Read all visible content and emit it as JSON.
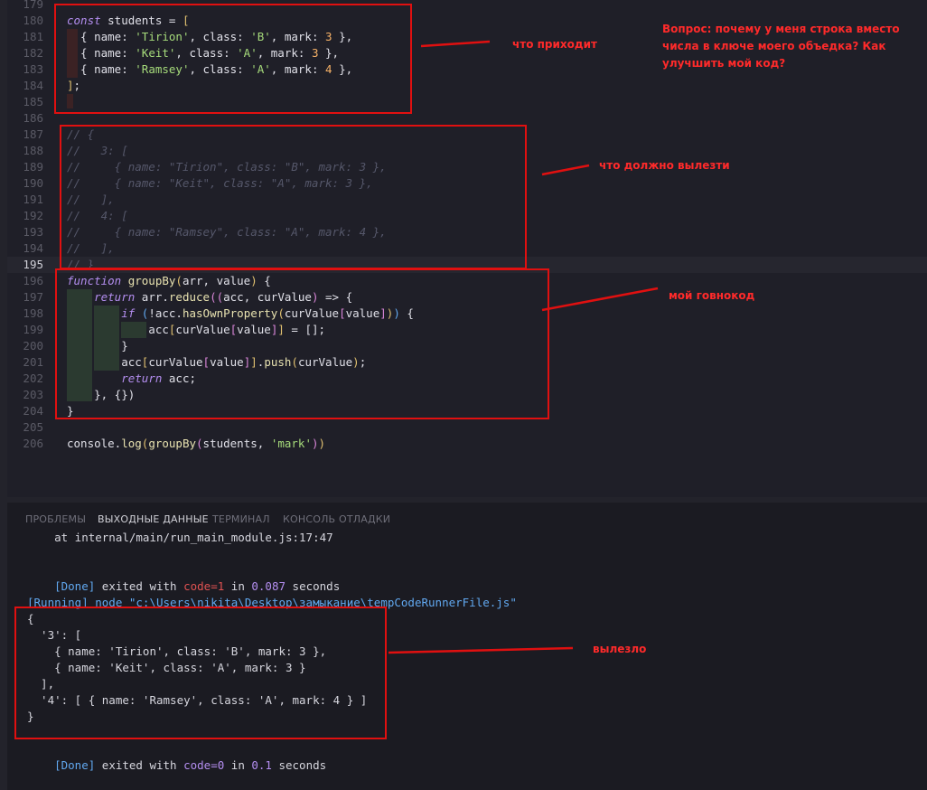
{
  "editor": {
    "lines": [
      {
        "n": "179",
        "segs": []
      },
      {
        "n": "180",
        "segs": [
          [
            "kw",
            "const "
          ],
          [
            "pr",
            "students = "
          ],
          [
            "br1",
            "["
          ]
        ]
      },
      {
        "n": "181",
        "segs": [
          [
            "pr",
            "  { name: "
          ],
          [
            "str",
            "'Tirion'"
          ],
          [
            "pr",
            ", class: "
          ],
          [
            "str",
            "'B'"
          ],
          [
            "pr",
            ", mark: "
          ],
          [
            "num",
            "3"
          ],
          [
            "pr",
            " },"
          ]
        ]
      },
      {
        "n": "182",
        "segs": [
          [
            "pr",
            "  { name: "
          ],
          [
            "str",
            "'Keit'"
          ],
          [
            "pr",
            ", class: "
          ],
          [
            "str",
            "'A'"
          ],
          [
            "pr",
            ", mark: "
          ],
          [
            "num",
            "3"
          ],
          [
            "pr",
            " },"
          ]
        ]
      },
      {
        "n": "183",
        "segs": [
          [
            "pr",
            "  { name: "
          ],
          [
            "str",
            "'Ramsey'"
          ],
          [
            "pr",
            ", class: "
          ],
          [
            "str",
            "'A'"
          ],
          [
            "pr",
            ", mark: "
          ],
          [
            "num",
            "4"
          ],
          [
            "pr",
            " },"
          ]
        ]
      },
      {
        "n": "184",
        "segs": [
          [
            "br1",
            "]"
          ],
          [
            "pr",
            ";"
          ]
        ]
      },
      {
        "n": "185",
        "segs": []
      },
      {
        "n": "186",
        "segs": []
      },
      {
        "n": "187",
        "segs": [
          [
            "cm",
            "// {"
          ]
        ]
      },
      {
        "n": "188",
        "segs": [
          [
            "cm",
            "//   3: ["
          ]
        ]
      },
      {
        "n": "189",
        "segs": [
          [
            "cm",
            "//     { name: \"Tirion\", class: \"B\", mark: 3 },"
          ]
        ]
      },
      {
        "n": "190",
        "segs": [
          [
            "cm",
            "//     { name: \"Keit\", class: \"A\", mark: 3 },"
          ]
        ]
      },
      {
        "n": "191",
        "segs": [
          [
            "cm",
            "//   ],"
          ]
        ]
      },
      {
        "n": "192",
        "segs": [
          [
            "cm",
            "//   4: ["
          ]
        ]
      },
      {
        "n": "193",
        "segs": [
          [
            "cm",
            "//     { name: \"Ramsey\", class: \"A\", mark: 4 },"
          ]
        ]
      },
      {
        "n": "194",
        "segs": [
          [
            "cm",
            "//   ],"
          ]
        ]
      },
      {
        "n": "195",
        "segs": [
          [
            "cm",
            "// }"
          ]
        ]
      },
      {
        "n": "196",
        "segs": [
          [
            "kw",
            "function "
          ],
          [
            "fn",
            "groupBy"
          ],
          [
            "br1",
            "("
          ],
          [
            "pr",
            "arr, value"
          ],
          [
            "br1",
            ")"
          ],
          [
            "pr",
            " {"
          ]
        ]
      },
      {
        "n": "197",
        "segs": [
          [
            "pr",
            "    "
          ],
          [
            "kw",
            "return "
          ],
          [
            "pr",
            "arr."
          ],
          [
            "fn",
            "reduce"
          ],
          [
            "br2",
            "(("
          ],
          [
            "pr",
            "acc, curValue"
          ],
          [
            "br2",
            ")"
          ],
          [
            "pr",
            " => {"
          ]
        ]
      },
      {
        "n": "198",
        "segs": [
          [
            "pr",
            "        "
          ],
          [
            "kw",
            "if "
          ],
          [
            "br3",
            "("
          ],
          [
            "pr",
            "!acc."
          ],
          [
            "fn",
            "hasOwnProperty"
          ],
          [
            "br1",
            "("
          ],
          [
            "pr",
            "curValue"
          ],
          [
            "br2",
            "["
          ],
          [
            "pr",
            "value"
          ],
          [
            "br2",
            "]"
          ],
          [
            "br1",
            ")"
          ],
          [
            "br3",
            ")"
          ],
          [
            "pr",
            " {"
          ]
        ]
      },
      {
        "n": "199",
        "segs": [
          [
            "pr",
            "            acc"
          ],
          [
            "br1",
            "["
          ],
          [
            "pr",
            "curValue"
          ],
          [
            "br2",
            "["
          ],
          [
            "pr",
            "value"
          ],
          [
            "br2",
            "]"
          ],
          [
            "br1",
            "]"
          ],
          [
            "pr",
            " = [];"
          ]
        ]
      },
      {
        "n": "200",
        "segs": [
          [
            "pr",
            "        }"
          ]
        ]
      },
      {
        "n": "201",
        "segs": [
          [
            "pr",
            "        acc"
          ],
          [
            "br1",
            "["
          ],
          [
            "pr",
            "curValue"
          ],
          [
            "br2",
            "["
          ],
          [
            "pr",
            "value"
          ],
          [
            "br2",
            "]"
          ],
          [
            "br1",
            "]"
          ],
          [
            "pr",
            "."
          ],
          [
            "fn",
            "push"
          ],
          [
            "br1",
            "("
          ],
          [
            "pr",
            "curValue"
          ],
          [
            "br1",
            ")"
          ],
          [
            "pr",
            ";"
          ]
        ]
      },
      {
        "n": "202",
        "segs": [
          [
            "pr",
            "        "
          ],
          [
            "kw",
            "return "
          ],
          [
            "pr",
            "acc;"
          ]
        ]
      },
      {
        "n": "203",
        "segs": [
          [
            "pr",
            "    }, {})"
          ]
        ]
      },
      {
        "n": "204",
        "segs": [
          [
            "pr",
            "}"
          ]
        ]
      },
      {
        "n": "205",
        "segs": []
      },
      {
        "n": "206",
        "segs": [
          [
            "pr",
            "console."
          ],
          [
            "fn",
            "log"
          ],
          [
            "br1",
            "("
          ],
          [
            "fn",
            "groupBy"
          ],
          [
            "br2",
            "("
          ],
          [
            "pr",
            "students, "
          ],
          [
            "str",
            "'mark'"
          ],
          [
            "br2",
            ")"
          ],
          [
            "br1",
            ")"
          ]
        ]
      }
    ]
  },
  "panel": {
    "tabs": [
      "ПРОБЛЕМЫ",
      "ВЫХОДНЫЕ ДАННЫЕ",
      "ТЕРМИНАЛ",
      "КОНСОЛЬ ОТЛАДКИ"
    ],
    "active_tab": 1,
    "output": {
      "trace": "    at internal/main/run_main_module.js:17:47",
      "done1": {
        "tag": "[Done]",
        "text1": " exited with ",
        "code": "code=1",
        "text2": " in ",
        "time": "0.087",
        "text3": " seconds"
      },
      "running": "[Running] node \"c:\\Users\\nikita\\Desktop\\замыкание\\tempCodeRunnerFile.js\"",
      "result_lines": [
        "{",
        "  '3': [",
        "    { name: 'Tirion', class: 'B', mark: 3 },",
        "    { name: 'Keit', class: 'A', mark: 3 }",
        "  ],",
        "  '4': [ { name: 'Ramsey', class: 'A', mark: 4 } ]",
        "}"
      ],
      "done2": {
        "tag": "[Done]",
        "text1": " exited with ",
        "code": "code=0",
        "text2": " in ",
        "time": "0.1",
        "text3": " seconds"
      }
    }
  },
  "annotations": {
    "incoming": "что приходит",
    "should_output": "что должно вылезти",
    "my_code": "мой говнокод",
    "result": "вылезло",
    "question_lines": [
      "Вопрос: почему у меня строка вместо",
      "числа в ключе моего объедка? Как",
      "улучшить мой код?"
    ]
  },
  "colors": {
    "annotation_red": "#e01010",
    "keyword": "#b48ef0",
    "string": "#a6db7b",
    "number": "#f7b267",
    "comment": "#55576a"
  }
}
